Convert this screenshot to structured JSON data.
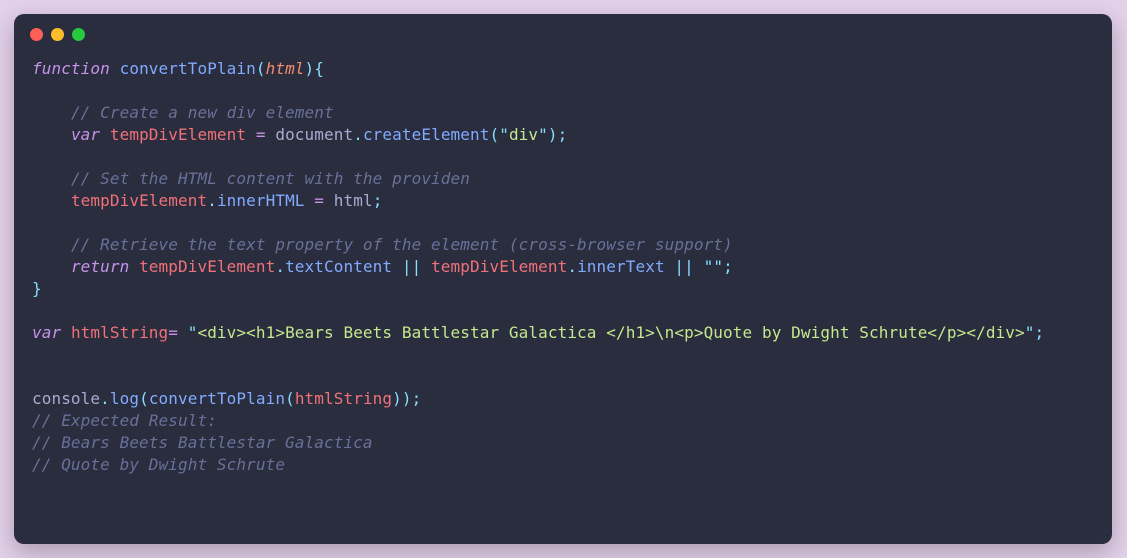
{
  "window": {
    "buttons": [
      "close",
      "minimize",
      "zoom"
    ]
  },
  "code": {
    "l1_kw": "function",
    "l1_name": "convertToPlain",
    "l1_param": "html",
    "c1": "// Create a new div element",
    "l2_kw": "var",
    "l2_ident": "tempDivElement",
    "l2_obj": "document",
    "l2_method": "createElement",
    "l2_arg": "div",
    "c2": "// Set the HTML content with the providen",
    "l3_ident": "tempDivElement",
    "l3_prop": "innerHTML",
    "l3_rhs": "html",
    "c3": "// Retrieve the text property of the element (cross-browser support)",
    "l4_kw": "return",
    "l4_a_ident": "tempDivElement",
    "l4_a_prop": "textContent",
    "l4_b_ident": "tempDivElement",
    "l4_b_prop": "innerText",
    "l4_fallback": "",
    "l5_kw": "var",
    "l5_ident": "htmlString",
    "l5_str": "<div><h1>Bears Beets Battlestar Galactica </h1>\\n<p>Quote by Dwight Schrute</p></div>",
    "l6_obj": "console",
    "l6_method": "log",
    "l6_fn": "convertToPlain",
    "l6_arg": "htmlString",
    "c4": "// Expected Result:",
    "c5": "// Bears Beets Battlestar Galactica",
    "c6": "// Quote by Dwight Schrute"
  }
}
